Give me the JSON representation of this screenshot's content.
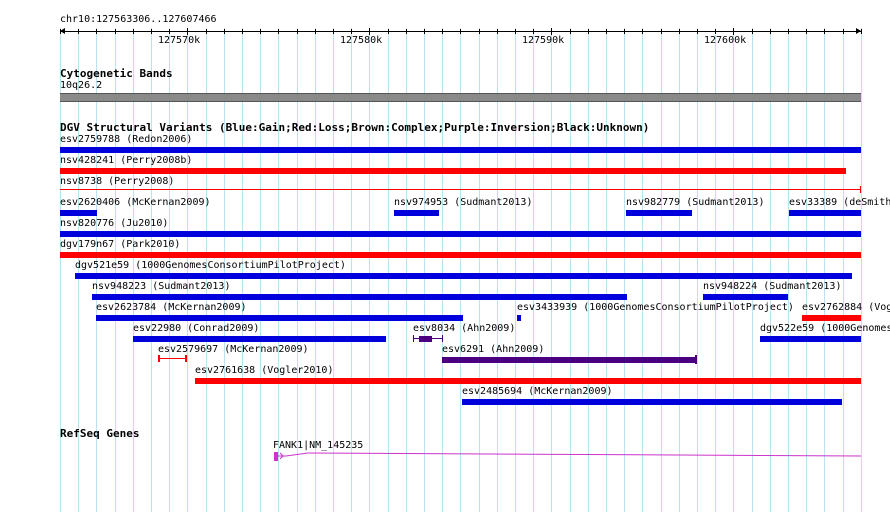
{
  "ruler": {
    "range_label": "chr10:127563306..127607466",
    "tick_labels": [
      "127570k",
      "127580k",
      "127590k",
      "127600k"
    ]
  },
  "tracks": {
    "cytoband_title": "Cytogenetic Bands",
    "cytoband_label": "10q26.2",
    "dgv_title": "DGV Structural Variants (Blue:Gain;Red:Loss;Brown:Complex;Purple:Inversion;Black:Unknown)",
    "refseq_title": "RefSeq Genes"
  },
  "colors": {
    "gain": "#0000dd",
    "loss": "#ff0000",
    "inversion": "#4b0082",
    "grid": "#b7e3f3",
    "gene": "#cc33cc"
  },
  "variants": [
    {
      "label": "esv2759788 (Redon2006)",
      "type": "gain"
    },
    {
      "label": "nsv428241 (Perry2008b)",
      "type": "loss"
    },
    {
      "label": "nsv8738 (Perry2008)",
      "type": "loss"
    },
    {
      "label": "esv2620406 (McKernan2009)",
      "type": "gain"
    },
    {
      "label": "nsv974953 (Sudmant2013)",
      "type": "gain"
    },
    {
      "label": "nsv982779 (Sudmant2013)",
      "type": "gain"
    },
    {
      "label": "esv33389 (deSmith",
      "type": "gain"
    },
    {
      "label": "nsv820776 (Ju2010)",
      "type": "gain"
    },
    {
      "label": "dgv179n67 (Park2010)",
      "type": "loss"
    },
    {
      "label": "dgv521e59 (1000GenomesConsortiumPilotProject)",
      "type": "gain"
    },
    {
      "label": "nsv948223 (Sudmant2013)",
      "type": "gain"
    },
    {
      "label": "nsv948224 (Sudmant2013)",
      "type": "gain"
    },
    {
      "label": "esv2623784 (McKernan2009)",
      "type": "gain"
    },
    {
      "label": "esv3433939 (1000GenomesConsortiumPilotProject)",
      "type": "gain"
    },
    {
      "label": "esv2762884 (Vog",
      "type": "loss"
    },
    {
      "label": "esv22980 (Conrad2009)",
      "type": "gain"
    },
    {
      "label": "esv8034 (Ahn2009)",
      "type": "inversion"
    },
    {
      "label": "dgv522e59 (1000Genomes",
      "type": "gain"
    },
    {
      "label": "esv2579697 (McKernan2009)",
      "type": "loss"
    },
    {
      "label": "esv6291 (Ahn2009)",
      "type": "inversion"
    },
    {
      "label": "esv2761638 (Vogler2010)",
      "type": "loss"
    },
    {
      "label": "esv2485694 (McKernan2009)",
      "type": "gain"
    }
  ],
  "gene": {
    "label": "FANK1|NM_145235"
  }
}
